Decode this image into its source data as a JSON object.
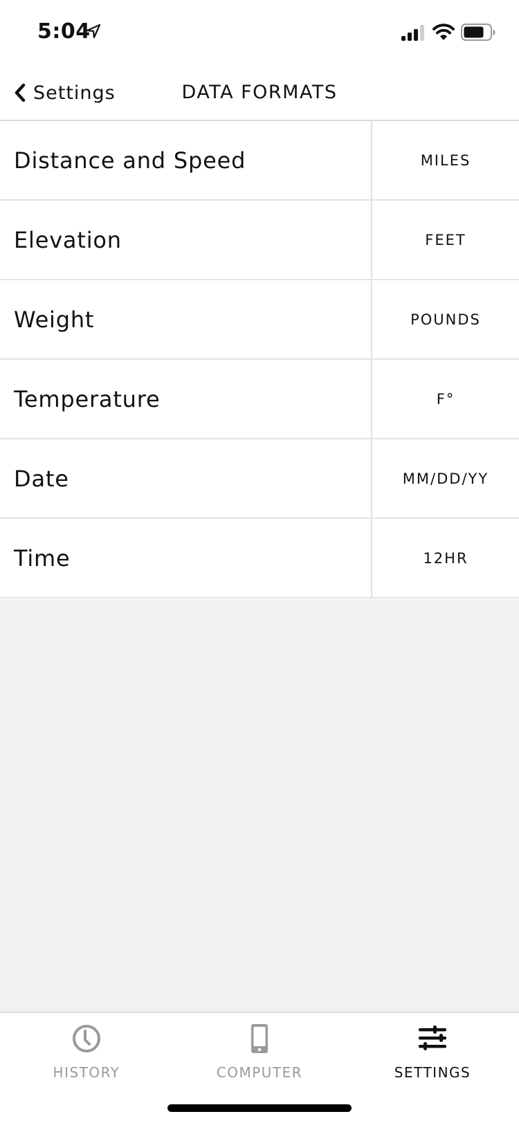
{
  "status_bar": {
    "time": "5:04",
    "icons": [
      "location-arrow-icon",
      "cellular-signal-icon",
      "wifi-icon",
      "battery-icon"
    ]
  },
  "nav": {
    "back_label": "Settings",
    "title": "DATA FORMATS"
  },
  "rows": [
    {
      "label": "Distance and Speed",
      "value": "MILES"
    },
    {
      "label": "Elevation",
      "value": "FEET"
    },
    {
      "label": "Weight",
      "value": "POUNDS"
    },
    {
      "label": "Temperature",
      "value": "F°"
    },
    {
      "label": "Date",
      "value": "MM/DD/YY"
    },
    {
      "label": "Time",
      "value": "12HR"
    }
  ],
  "tab_bar": {
    "tabs": [
      {
        "label": "HISTORY",
        "icon": "clock-icon",
        "active": false
      },
      {
        "label": "COMPUTER",
        "icon": "phone-icon",
        "active": false
      },
      {
        "label": "SETTINGS",
        "icon": "sliders-icon",
        "active": true
      }
    ]
  },
  "colors": {
    "active": "#111111",
    "inactive": "#9a9a9a",
    "empty_background": "#f1f1f1",
    "divider": "#e0e0e0"
  }
}
